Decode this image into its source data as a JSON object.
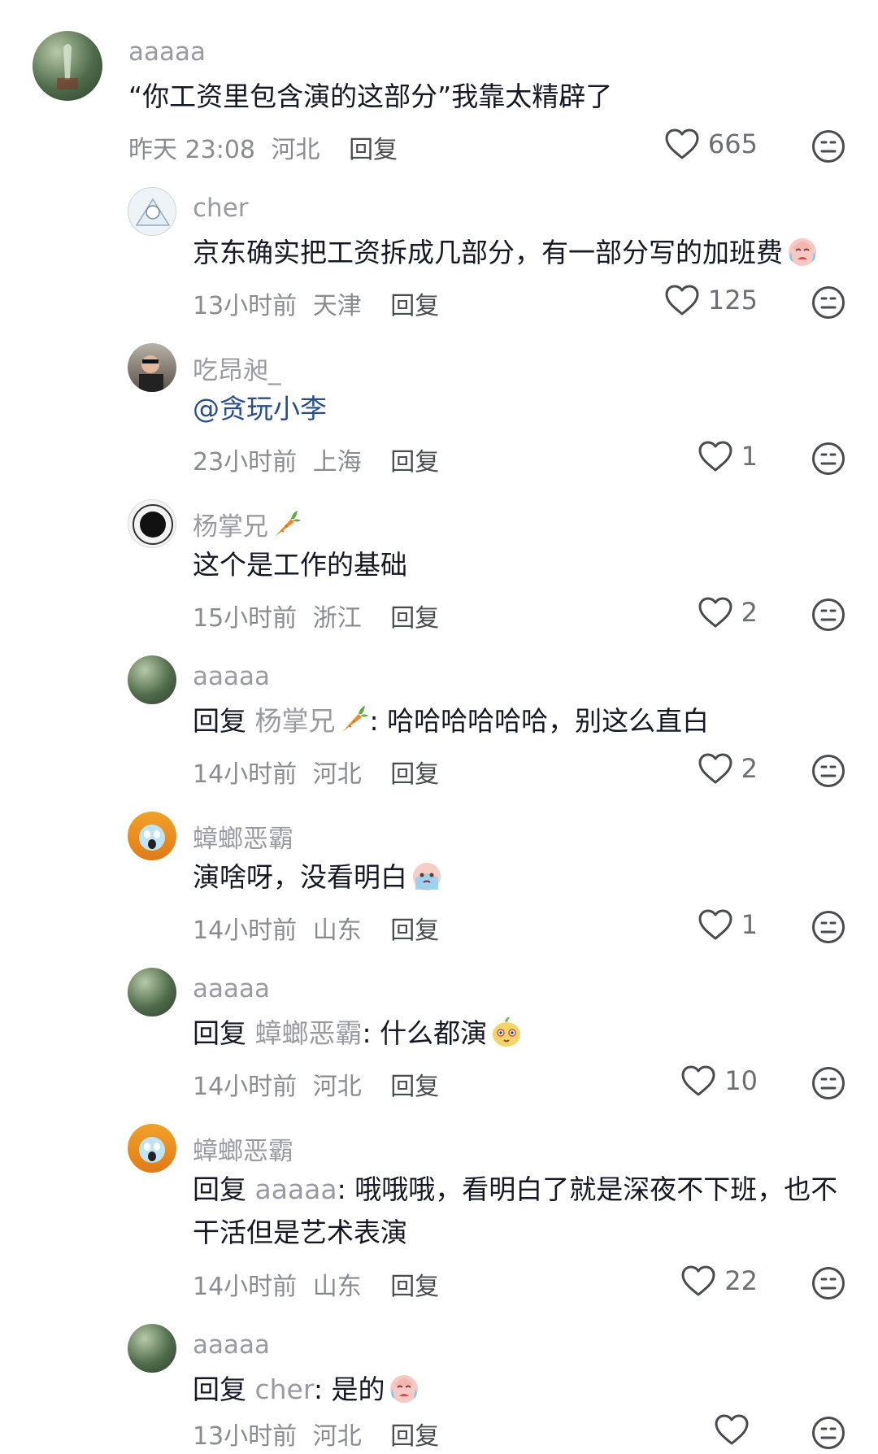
{
  "comments": [
    {
      "user": "aaaaa",
      "text": "“你工资里包含演的这部分”我靠太精辟了",
      "time": "昨天 23:08",
      "location": "河北",
      "reply_label": "回复",
      "likes": "665"
    },
    {
      "user": "cher",
      "text": "京东确实把工资拆成几部分，有一部分写的加班费",
      "time": "13小时前",
      "location": "天津",
      "reply_label": "回复",
      "likes": "125"
    },
    {
      "user": "吃昂昶_",
      "text": "@贪玩小李",
      "time": "23小时前",
      "location": "上海",
      "reply_label": "回复",
      "likes": "1"
    },
    {
      "user": "杨掌兄",
      "text": "这个是工作的基础",
      "time": "15小时前",
      "location": "浙江",
      "reply_label": "回复",
      "likes": "2"
    },
    {
      "user": "aaaaa",
      "reply_prefix": "回复",
      "reply_to": "杨掌兄",
      "text": ": 哈哈哈哈哈哈，别这么直白",
      "time": "14小时前",
      "location": "河北",
      "reply_label": "回复",
      "likes": "2"
    },
    {
      "user": "蟑螂恶霸",
      "text": "演啥呀，没看明白",
      "time": "14小时前",
      "location": "山东",
      "reply_label": "回复",
      "likes": "1"
    },
    {
      "user": "aaaaa",
      "reply_prefix": "回复",
      "reply_to": "蟑螂恶霸",
      "text": ": 什么都演",
      "time": "14小时前",
      "location": "河北",
      "reply_label": "回复",
      "likes": "10"
    },
    {
      "user": "蟑螂恶霸",
      "reply_prefix": "回复",
      "reply_to": "aaaaa",
      "text": ": 哦哦哦，看明白了就是深夜不下班，也不干活但是艺术表演",
      "time": "14小时前",
      "location": "山东",
      "reply_label": "回复",
      "likes": "22"
    },
    {
      "user": "aaaaa",
      "reply_prefix": "回复",
      "reply_to": "cher",
      "text": ": 是的",
      "time": "13小时前",
      "location": "河北",
      "reply_label": "回复",
      "likes": ""
    }
  ],
  "icons": {
    "like": "heart-outline-icon",
    "dislike": "neutral-face-icon"
  },
  "colors": {
    "text": "#161823",
    "secondary": "#8a8b91",
    "mention": "#2b4e86"
  }
}
